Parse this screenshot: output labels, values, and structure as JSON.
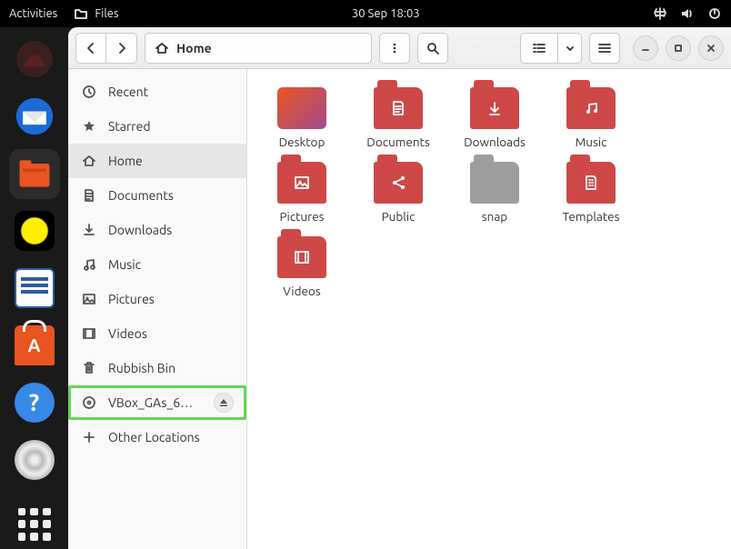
{
  "topbar": {
    "activities": "Activities",
    "app_name": "Files",
    "datetime": "30 Sep  18:03"
  },
  "pathbar": {
    "location": "Home"
  },
  "sidebar": {
    "recent": "Recent",
    "starred": "Starred",
    "home": "Home",
    "documents": "Documents",
    "downloads": "Downloads",
    "music": "Music",
    "pictures": "Pictures",
    "videos": "Videos",
    "trash": "Rubbish Bin",
    "disc": "VBox_GAs_6.…",
    "other": "Other Locations"
  },
  "files": {
    "desktop": "Desktop",
    "documents": "Documents",
    "downloads": "Downloads",
    "music": "Music",
    "pictures": "Pictures",
    "public": "Public",
    "snap": "snap",
    "templates": "Templates",
    "videos": "Videos"
  }
}
